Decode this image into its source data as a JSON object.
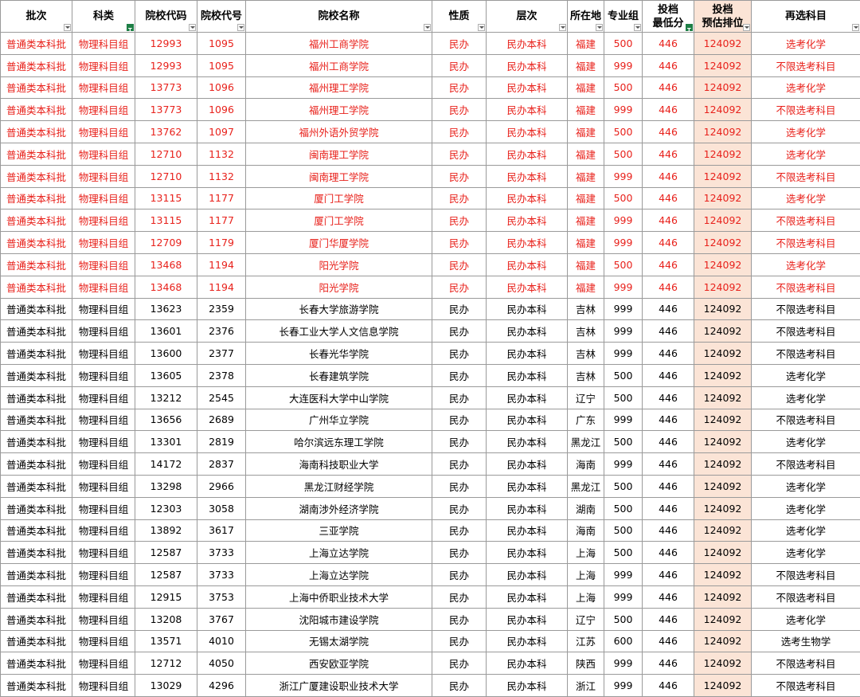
{
  "headers": [
    {
      "key": "batch",
      "lines": [
        "批次"
      ],
      "filter_active": false
    },
    {
      "key": "subject",
      "lines": [
        "科类"
      ],
      "filter_active": true
    },
    {
      "key": "school_code",
      "lines": [
        "院校代码"
      ],
      "filter_active": false
    },
    {
      "key": "school_id",
      "lines": [
        "院校代号"
      ],
      "filter_active": false
    },
    {
      "key": "school_name",
      "lines": [
        "院校名称"
      ],
      "filter_active": false
    },
    {
      "key": "nature",
      "lines": [
        "性质"
      ],
      "filter_active": false
    },
    {
      "key": "level",
      "lines": [
        "层次"
      ],
      "filter_active": false
    },
    {
      "key": "province",
      "lines": [
        "所在地"
      ],
      "filter_active": false
    },
    {
      "key": "major_group",
      "lines": [
        "专业组"
      ],
      "filter_active": false
    },
    {
      "key": "min_score",
      "lines": [
        "投档",
        "最低分"
      ],
      "filter_active": true
    },
    {
      "key": "rank",
      "lines": [
        "投档",
        "预估排位"
      ],
      "filter_active": false
    },
    {
      "key": "reselect",
      "lines": [
        "再选科目"
      ],
      "filter_active": false
    }
  ],
  "colors": {
    "highlight_text": "#e8211b",
    "rank_column_bg": "#fbe4d6",
    "filter_active": "#1e7f46"
  },
  "rows": [
    {
      "highlight": true,
      "cells": [
        "普通类本科批",
        "物理科目组",
        "12993",
        "1095",
        "福州工商学院",
        "民办",
        "民办本科",
        "福建",
        "500",
        "446",
        "124092",
        "选考化学"
      ]
    },
    {
      "highlight": true,
      "cells": [
        "普通类本科批",
        "物理科目组",
        "12993",
        "1095",
        "福州工商学院",
        "民办",
        "民办本科",
        "福建",
        "999",
        "446",
        "124092",
        "不限选考科目"
      ]
    },
    {
      "highlight": true,
      "cells": [
        "普通类本科批",
        "物理科目组",
        "13773",
        "1096",
        "福州理工学院",
        "民办",
        "民办本科",
        "福建",
        "500",
        "446",
        "124092",
        "选考化学"
      ]
    },
    {
      "highlight": true,
      "cells": [
        "普通类本科批",
        "物理科目组",
        "13773",
        "1096",
        "福州理工学院",
        "民办",
        "民办本科",
        "福建",
        "999",
        "446",
        "124092",
        "不限选考科目"
      ]
    },
    {
      "highlight": true,
      "cells": [
        "普通类本科批",
        "物理科目组",
        "13762",
        "1097",
        "福州外语外贸学院",
        "民办",
        "民办本科",
        "福建",
        "500",
        "446",
        "124092",
        "选考化学"
      ]
    },
    {
      "highlight": true,
      "cells": [
        "普通类本科批",
        "物理科目组",
        "12710",
        "1132",
        "闽南理工学院",
        "民办",
        "民办本科",
        "福建",
        "500",
        "446",
        "124092",
        "选考化学"
      ]
    },
    {
      "highlight": true,
      "cells": [
        "普通类本科批",
        "物理科目组",
        "12710",
        "1132",
        "闽南理工学院",
        "民办",
        "民办本科",
        "福建",
        "999",
        "446",
        "124092",
        "不限选考科目"
      ]
    },
    {
      "highlight": true,
      "cells": [
        "普通类本科批",
        "物理科目组",
        "13115",
        "1177",
        "厦门工学院",
        "民办",
        "民办本科",
        "福建",
        "500",
        "446",
        "124092",
        "选考化学"
      ]
    },
    {
      "highlight": true,
      "cells": [
        "普通类本科批",
        "物理科目组",
        "13115",
        "1177",
        "厦门工学院",
        "民办",
        "民办本科",
        "福建",
        "999",
        "446",
        "124092",
        "不限选考科目"
      ]
    },
    {
      "highlight": true,
      "cells": [
        "普通类本科批",
        "物理科目组",
        "12709",
        "1179",
        "厦门华厦学院",
        "民办",
        "民办本科",
        "福建",
        "999",
        "446",
        "124092",
        "不限选考科目"
      ]
    },
    {
      "highlight": true,
      "cells": [
        "普通类本科批",
        "物理科目组",
        "13468",
        "1194",
        "阳光学院",
        "民办",
        "民办本科",
        "福建",
        "500",
        "446",
        "124092",
        "选考化学"
      ]
    },
    {
      "highlight": true,
      "cells": [
        "普通类本科批",
        "物理科目组",
        "13468",
        "1194",
        "阳光学院",
        "民办",
        "民办本科",
        "福建",
        "999",
        "446",
        "124092",
        "不限选考科目"
      ]
    },
    {
      "highlight": false,
      "cells": [
        "普通类本科批",
        "物理科目组",
        "13623",
        "2359",
        "长春大学旅游学院",
        "民办",
        "民办本科",
        "吉林",
        "999",
        "446",
        "124092",
        "不限选考科目"
      ]
    },
    {
      "highlight": false,
      "cells": [
        "普通类本科批",
        "物理科目组",
        "13601",
        "2376",
        "长春工业大学人文信息学院",
        "民办",
        "民办本科",
        "吉林",
        "999",
        "446",
        "124092",
        "不限选考科目"
      ]
    },
    {
      "highlight": false,
      "cells": [
        "普通类本科批",
        "物理科目组",
        "13600",
        "2377",
        "长春光华学院",
        "民办",
        "民办本科",
        "吉林",
        "999",
        "446",
        "124092",
        "不限选考科目"
      ]
    },
    {
      "highlight": false,
      "cells": [
        "普通类本科批",
        "物理科目组",
        "13605",
        "2378",
        "长春建筑学院",
        "民办",
        "民办本科",
        "吉林",
        "500",
        "446",
        "124092",
        "选考化学"
      ]
    },
    {
      "highlight": false,
      "cells": [
        "普通类本科批",
        "物理科目组",
        "13212",
        "2545",
        "大连医科大学中山学院",
        "民办",
        "民办本科",
        "辽宁",
        "500",
        "446",
        "124092",
        "选考化学"
      ]
    },
    {
      "highlight": false,
      "cells": [
        "普通类本科批",
        "物理科目组",
        "13656",
        "2689",
        "广州华立学院",
        "民办",
        "民办本科",
        "广东",
        "999",
        "446",
        "124092",
        "不限选考科目"
      ]
    },
    {
      "highlight": false,
      "cells": [
        "普通类本科批",
        "物理科目组",
        "13301",
        "2819",
        "哈尔滨远东理工学院",
        "民办",
        "民办本科",
        "黑龙江",
        "500",
        "446",
        "124092",
        "选考化学"
      ]
    },
    {
      "highlight": false,
      "cells": [
        "普通类本科批",
        "物理科目组",
        "14172",
        "2837",
        "海南科技职业大学",
        "民办",
        "民办本科",
        "海南",
        "999",
        "446",
        "124092",
        "不限选考科目"
      ]
    },
    {
      "highlight": false,
      "cells": [
        "普通类本科批",
        "物理科目组",
        "13298",
        "2966",
        "黑龙江财经学院",
        "民办",
        "民办本科",
        "黑龙江",
        "500",
        "446",
        "124092",
        "选考化学"
      ]
    },
    {
      "highlight": false,
      "cells": [
        "普通类本科批",
        "物理科目组",
        "12303",
        "3058",
        "湖南涉外经济学院",
        "民办",
        "民办本科",
        "湖南",
        "500",
        "446",
        "124092",
        "选考化学"
      ]
    },
    {
      "highlight": false,
      "cells": [
        "普通类本科批",
        "物理科目组",
        "13892",
        "3617",
        "三亚学院",
        "民办",
        "民办本科",
        "海南",
        "500",
        "446",
        "124092",
        "选考化学"
      ]
    },
    {
      "highlight": false,
      "cells": [
        "普通类本科批",
        "物理科目组",
        "12587",
        "3733",
        "上海立达学院",
        "民办",
        "民办本科",
        "上海",
        "500",
        "446",
        "124092",
        "选考化学"
      ]
    },
    {
      "highlight": false,
      "cells": [
        "普通类本科批",
        "物理科目组",
        "12587",
        "3733",
        "上海立达学院",
        "民办",
        "民办本科",
        "上海",
        "999",
        "446",
        "124092",
        "不限选考科目"
      ]
    },
    {
      "highlight": false,
      "cells": [
        "普通类本科批",
        "物理科目组",
        "12915",
        "3753",
        "上海中侨职业技术大学",
        "民办",
        "民办本科",
        "上海",
        "999",
        "446",
        "124092",
        "不限选考科目"
      ]
    },
    {
      "highlight": false,
      "cells": [
        "普通类本科批",
        "物理科目组",
        "13208",
        "3767",
        "沈阳城市建设学院",
        "民办",
        "民办本科",
        "辽宁",
        "500",
        "446",
        "124092",
        "选考化学"
      ]
    },
    {
      "highlight": false,
      "cells": [
        "普通类本科批",
        "物理科目组",
        "13571",
        "4010",
        "无锡太湖学院",
        "民办",
        "民办本科",
        "江苏",
        "600",
        "446",
        "124092",
        "选考生物学"
      ]
    },
    {
      "highlight": false,
      "cells": [
        "普通类本科批",
        "物理科目组",
        "12712",
        "4050",
        "西安欧亚学院",
        "民办",
        "民办本科",
        "陕西",
        "999",
        "446",
        "124092",
        "不限选考科目"
      ]
    },
    {
      "highlight": false,
      "cells": [
        "普通类本科批",
        "物理科目组",
        "13029",
        "4296",
        "浙江广厦建设职业技术大学",
        "民办",
        "民办本科",
        "浙江",
        "999",
        "446",
        "124092",
        "不限选考科目"
      ]
    }
  ]
}
